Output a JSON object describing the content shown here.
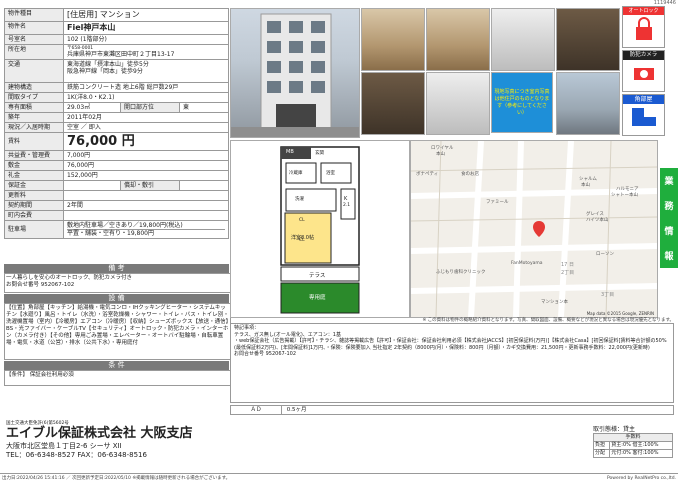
{
  "corner_id": "1119446",
  "property": {
    "type_label": "物件種目",
    "type_value": "[住居用] マンション",
    "name_label": "物件名",
    "name_value": "Fiel神戸本山",
    "room_label": "号室名",
    "room_value": "102 (1階部分)",
    "address_label": "所在地",
    "address_zip": "〒658-0001",
    "address_value": "兵庫県神戸市東灘区田中町２丁目13-17",
    "traffic_label": "交通",
    "traffic_line1": "東海道線「摂津本山」徒歩5分",
    "traffic_line2": "阪急神戸線「岡本」徒歩9分",
    "structure_label": "建物構造",
    "structure_value": "鉄筋コンクリート造 地上6階 総戸数29戸",
    "layout_label": "間取タイプ",
    "layout_value": "1K(洋8.0・K2.1)",
    "area_label": "専有面積",
    "area_value": "29.03㎡",
    "opening_label": "開口部方位",
    "opening_value": "東",
    "built_label": "築年",
    "built_value": "2011年02月",
    "status_label": "現況／入居時期",
    "status_value": "空室 ／ 即入",
    "rent_label": "賃料",
    "rent_value": "76,000 円",
    "kyoeki_label": "共益費・管理費",
    "kyoeki_value": "7,000円",
    "shiki_label": "敷金",
    "shiki_value": "76,000円",
    "rei_label": "礼金",
    "rei_value": "152,000円",
    "hosho_label": "保証金",
    "hosho_value": "",
    "kyakubiki_label": "償却・敷引",
    "kyakubiki_value": "",
    "koshin_label": "更新料",
    "koshin_value": "",
    "keiyaku_label": "契約期間",
    "keiyaku_value": "2年間",
    "chonai_label": "町内会費",
    "chonai_value": "",
    "parking_label": "駐車場",
    "parking_line1": "敷地内駐車場／空きあり／19,800円(税込)",
    "parking_line2": "平置・舗装・空有り・19,800円"
  },
  "sections": {
    "biko_title": "備 考",
    "biko_text1": "一人暮らしを安心のオートロック、防犯カメラ付き",
    "biko_text2": "お問合せ番号 952067-102",
    "setsubi_title": "設 備",
    "setsubi_text": "【位置】角部屋【キッチン】給湯機・電気コンロ・IHクッキングヒーター・システムキッチン【水廻り】風呂・トイレ（水洗）・浴室乾燥機・シャワー・トイレ・バス・トイレ別・洗濯機置場（室内）【冷暖房】エアコン（冷暖房）【収納】シューズボックス【放送・通信】BS・光ファイバー・ケーブルTV【セキュリティ】オートロック・防犯カメラ・インターホン（カメラ付き）【その他】専用ごみ置場・エレベーター・オートバイ駐輪場・自転車置場・電気・水道（公営）・排水（公共下水）・専用庭付",
    "joken_title": "条 件",
    "joken_text": "【条件】 保証会社利用必須"
  },
  "badges": {
    "autolock": "オートロック",
    "camera": "防犯カメラ",
    "kado": "角部屋"
  },
  "photo_note": "現地写真につき室内写真は他住戸のものとなります（参考にしてください）",
  "plan": {
    "mb": "MB",
    "genkan": "玄関",
    "k_label": "K",
    "k_size": "2.1",
    "kitchen": "冷蔵庫",
    "bath": "浴室",
    "sento": "洗濯",
    "cl1": "CL",
    "cl2": "CL",
    "yo": "洋室8.0帖",
    "terrace": "テラス",
    "garden": "専用庭"
  },
  "map": {
    "l1": "ロワイヤル",
    "l2": "本山",
    "l3": "ボナペティ",
    "l4": "食のお店",
    "l5": "シャルム",
    "l6": "本山",
    "l7": "ハルモニア",
    "l8": "シャトー本山",
    "l9": "ファミール",
    "l10": "グレイス",
    "l11": "ハイツ本山",
    "l12": "ふじもり歯科クリニック",
    "l13": "FanMotoyama",
    "l14": "ローソン",
    "l15": "マンション本",
    "l16": "17 日",
    "l17": "2丁目",
    "l18": "3丁目",
    "credit": "Map data ©2015 Google, ZENRIN"
  },
  "side_tab": [
    "業",
    "務",
    "情",
    "報"
  ],
  "notice": "※ この資料は物件の概略紹介資料となります。写真、間取図面、設備、概要などが現況と異なる場合は現況優先となります。",
  "notes": {
    "title": "特記事項：",
    "text": "テラス、ガス無し(オール電化)、エアコン：1基\n・web保証会社（広告掲載）【許可】・チラシ、雑誌等掲載広告【許可】・保証会社：保証会社利用必須【株式会社JACCS】[初回保証料(万円)]【株式会社Casa】[初回保証料]賃料等合計額の50%(最低保証料2万円)、[年間保証料]1万円、・保険：保険要加入 当社指定 2年契約（8000円/月）・保険料：800円（月額）・カギ交換費用：21,500円・更新事務手数料：22,000円(更新時)\nお問合せ番号 952067-102"
  },
  "ad": {
    "label": "ＡＤ",
    "value": "0.5ヶ月"
  },
  "company": {
    "license": "国土交通大臣免許(6)第5602号",
    "name": "エイブル保証株式会社 大阪支店",
    "address": "大阪市北区堂島１丁目2-6 シーサ XII",
    "tel": "TEL：06-6348-8527  FAX：06-6348-8516"
  },
  "torihiki": {
    "title": "取引態様：貸主",
    "fee_header": "手数料",
    "row1_label": "負担",
    "row1_value": "貸主:0% 借主:100%",
    "row2_label": "分配",
    "row2_value": "元付:0% 客付:100%"
  },
  "footer": {
    "left": "出力日:2022/04/26 15:41:16 ／ 次回更新予定日:2022/05/10 ※掲載情報は随時更新される場合がございます。",
    "right": "Powered by RealNetPro co.,ltd."
  }
}
